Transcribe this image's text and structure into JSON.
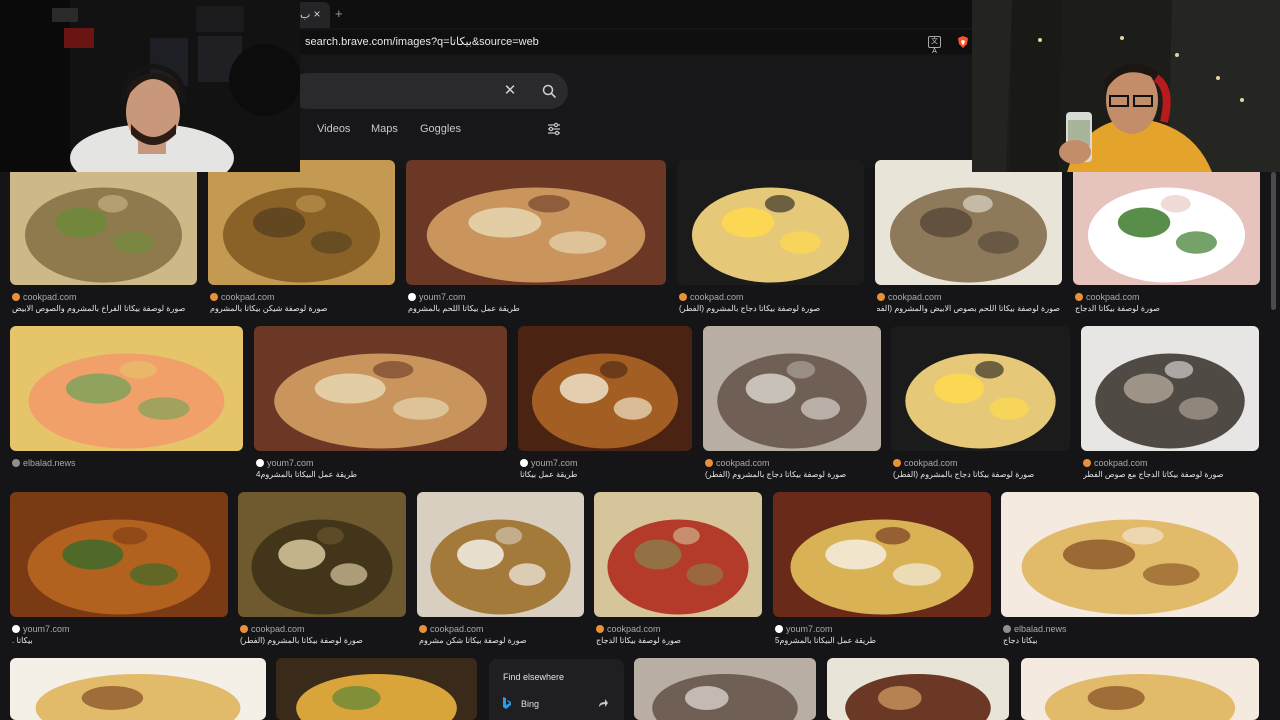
{
  "browser": {
    "tab_title": "ب",
    "tab_close": "×",
    "new_tab": "+",
    "url": "search.brave.com/images?q=بيكاتا&source=web"
  },
  "search": {
    "clear_icon": "✕",
    "tabs": [
      "Videos",
      "Maps",
      "Goggles"
    ]
  },
  "results": [
    {
      "source": "cookpad.com",
      "caption": "صورة لوصفة بيكاتا الفراخ بالمشروم والصوص الابيض",
      "icon": "orange"
    },
    {
      "source": "cookpad.com",
      "caption": "صورة لوصفة شيكن بيكاتا بالمشروم",
      "icon": "orange"
    },
    {
      "source": "youm7.com",
      "caption": "طريقة عمل بيكاتا اللحم بالمشروم",
      "icon": "black"
    },
    {
      "source": "cookpad.com",
      "caption": "صورة لوصفة بيكاتا دجاج بالمشروم (الفطر)",
      "icon": "orange"
    },
    {
      "source": "cookpad.com",
      "caption": "صورة لوصفة بيكاتا اللحم بصوص الابيض والمشروم (الفطر)",
      "icon": "orange"
    },
    {
      "source": "cookpad.com",
      "caption": "صورة لوصفة بيكاتا الدجاج",
      "icon": "orange"
    },
    {
      "source": "elbalad.news",
      "caption": "",
      "icon": "gray"
    },
    {
      "source": "youm7.com",
      "caption": "طريقة عمل البيكاتا بالمشروم4",
      "icon": "black"
    },
    {
      "source": "youm7.com",
      "caption": "طريقة عمل بيكاتا",
      "icon": "black"
    },
    {
      "source": "cookpad.com",
      "caption": "صورة لوصفة بيكاتا دجاج بالمشروم (الفطر)",
      "icon": "orange"
    },
    {
      "source": "cookpad.com",
      "caption": "صورة لوصفة بيكاتا دجاج بالمشروم (الفطر)",
      "icon": "orange"
    },
    {
      "source": "cookpad.com",
      "caption": "صورة لوصفة بيكاتا الدجاج مع صوص الفطر",
      "icon": "orange"
    },
    {
      "source": "youm7.com",
      "caption": "بيكاتا .",
      "icon": "black"
    },
    {
      "source": "cookpad.com",
      "caption": "صورة لوصفة بيكاتا بالمشروم (الفطر)",
      "icon": "orange"
    },
    {
      "source": "cookpad.com",
      "caption": "صورة لوصفة بيكاتا شكن مشروم",
      "icon": "orange"
    },
    {
      "source": "cookpad.com",
      "caption": "صورة لوصفة بيكاتا الدجاج",
      "icon": "orange"
    },
    {
      "source": "youm7.com",
      "caption": "طريقة عمل البيكاتا بالمشروم5",
      "icon": "black"
    },
    {
      "source": "elbalad.news",
      "caption": "بيكاتا دجاج",
      "icon": "gray"
    }
  ],
  "find_elsewhere": {
    "title": "Find elsewhere",
    "bing_label": "Bing"
  },
  "colors": {
    "background": "#151517",
    "search_box": "#2a2a2e",
    "cookpad_icon": "#e8913a",
    "youm7_icon": "#ffffff",
    "elbalad_icon": "#8e8e93"
  }
}
